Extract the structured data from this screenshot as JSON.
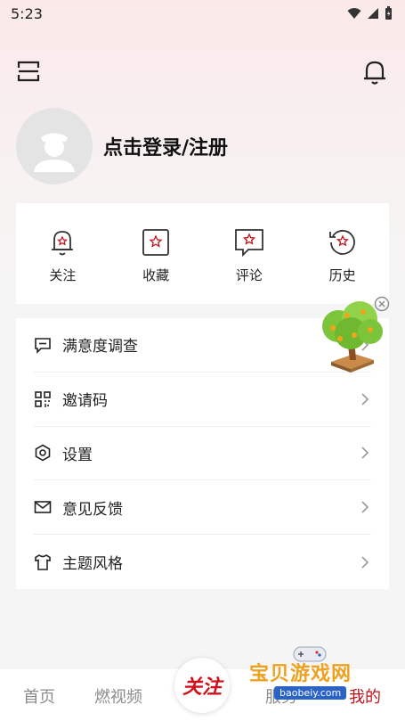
{
  "status_bar": {
    "time": "5:23"
  },
  "profile": {
    "login_label": "点击登录/注册"
  },
  "quick_actions": [
    {
      "label": "关注",
      "icon": "bell-badge-icon"
    },
    {
      "label": "收藏",
      "icon": "star-box-icon"
    },
    {
      "label": "评论",
      "icon": "star-comment-icon"
    },
    {
      "label": "历史",
      "icon": "history-star-icon"
    }
  ],
  "menu": [
    {
      "label": "满意度调查",
      "icon": "survey-chat-icon"
    },
    {
      "label": "邀请码",
      "icon": "grid-code-icon"
    },
    {
      "label": "设置",
      "icon": "settings-hex-icon"
    },
    {
      "label": "意见反馈",
      "icon": "mail-icon"
    },
    {
      "label": "主题风格",
      "icon": "shirt-icon"
    }
  ],
  "bottom_nav": {
    "home": "首页",
    "video": "燃视频",
    "center": "关注",
    "service": "服务",
    "mine": "我的"
  },
  "watermark": {
    "title": "宝贝游戏网",
    "url": "baobeiy.com"
  },
  "colors": {
    "accent": "#c0121c",
    "background": "#f5f5f5"
  }
}
